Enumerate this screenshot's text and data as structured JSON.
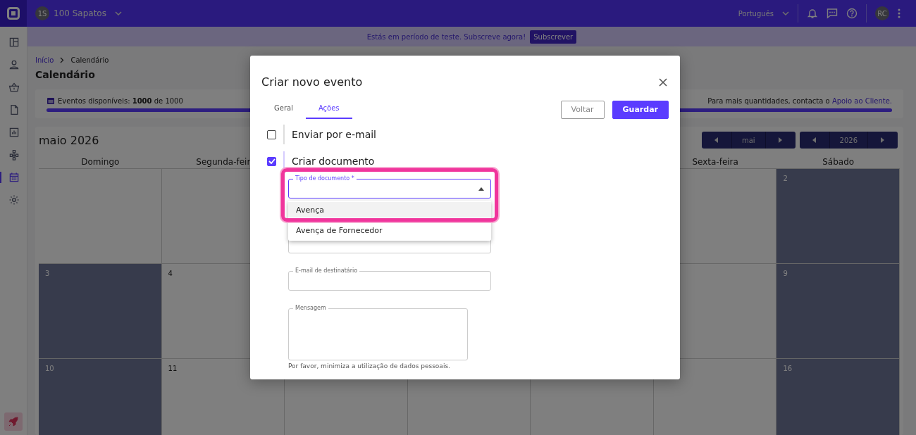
{
  "topbar": {
    "company_initials": "1S",
    "company": "100 Sapatos",
    "language": "Português",
    "user_initials": "RC"
  },
  "sidebar": {
    "items": [
      {
        "selected": false
      },
      {
        "selected": false
      },
      {
        "selected": false
      },
      {
        "selected": false
      },
      {
        "selected": false
      },
      {
        "selected": false
      },
      {
        "selected": true
      },
      {
        "selected": false
      }
    ]
  },
  "banner": {
    "text": "Estás em período de teste. Subscreve agora!",
    "button": "Subscrever"
  },
  "breadcrumb": [
    "Início",
    "Calendário"
  ],
  "page_title": "Calendário",
  "quota": {
    "text": "Eventos disponíveis: **1000** de 1000",
    "level": 1,
    "note": "Para mais quantidades, contacta o",
    "link": "Apoio ao Cliente."
  },
  "calendar": {
    "title": "maio 2026",
    "month": "mai",
    "year": "2026",
    "columns": [
      {
        "label": "Domingo"
      },
      {
        "label": "Segunda-feir"
      },
      {},
      {},
      {},
      {
        "label": "Sexta-feira"
      },
      {
        "label": "Sábado"
      }
    ],
    "rows": [
      [
        {
          "shaded": false
        },
        {
          "shaded": false
        },
        {},
        {},
        {},
        {
          "shaded": false
        },
        {
          "shaded": true,
          "day": "2"
        }
      ],
      [
        {
          "shaded": true,
          "day": "3"
        },
        {
          "shaded": false,
          "day": "4"
        },
        {},
        {},
        {},
        {
          "shaded": false
        },
        {
          "shaded": true,
          "day": "9"
        }
      ],
      [
        {
          "shaded": true,
          "day": "10"
        },
        {
          "shaded": false,
          "day": "11"
        },
        {},
        {},
        {},
        {
          "shaded": false
        },
        {
          "shaded": true,
          "day": "16"
        }
      ]
    ]
  },
  "dialog": {
    "title": "Criar novo evento",
    "tabs": [
      {
        "label": "Geral",
        "selected": false
      },
      {
        "label": "Ações",
        "selected": true
      }
    ],
    "buttons": [
      {
        "label": "Voltar",
        "kind": "secondary"
      },
      {
        "label": "Guardar",
        "kind": "primary"
      }
    ],
    "actions": [
      {
        "label": "Enviar por e-mail",
        "checked": false
      },
      {
        "label": "Criar documento",
        "checked": true
      }
    ],
    "select": {
      "label": "Tipo de documento *",
      "expanded": true,
      "options": [
        {
          "label": "Avença",
          "selected": true
        },
        {
          "label": "Avença de Fornecedor",
          "selected": false
        }
      ]
    },
    "email_field": {
      "label": "E-mail de destinatário"
    },
    "message_field": {
      "label": "Mensagem",
      "hint": "Por favor, minimiza a utilização de dados pessoais."
    }
  }
}
